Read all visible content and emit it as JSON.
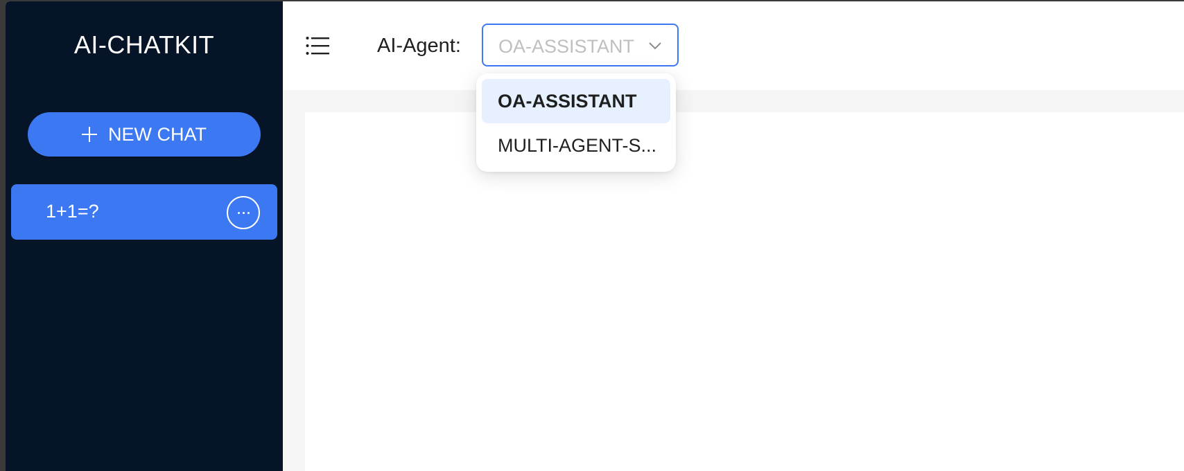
{
  "sidebar": {
    "logo": "AI-CHATKIT",
    "new_chat_label": "NEW CHAT",
    "chats": [
      {
        "label": "1+1=?"
      }
    ]
  },
  "header": {
    "agent_label": "AI-Agent:",
    "agent_select": {
      "placeholder_value": "OA-ASSISTANT",
      "options": [
        "OA-ASSISTANT",
        "MULTI-AGENT-S..."
      ],
      "highlighted_option": "OA-ASSISTANT"
    }
  },
  "icons": {
    "menu": "list-menu-icon",
    "new_chat": "plus-icon",
    "chat_more": "ellipsis-icon",
    "select": "chevron-down-icon"
  },
  "colors": {
    "sidebar_bg": "#051427",
    "accent": "#3b78f2",
    "option_highlight": "#e6f0fe",
    "content_bg": "#f5f5f5"
  }
}
